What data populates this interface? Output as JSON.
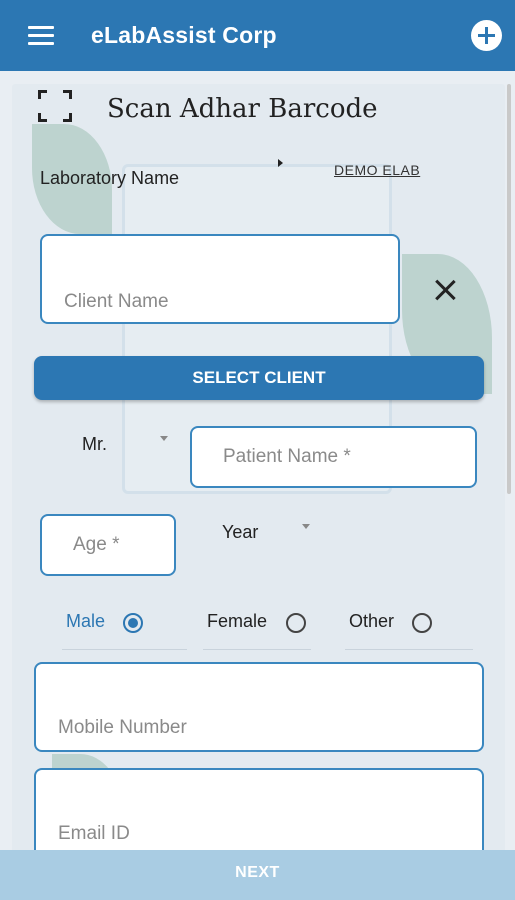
{
  "appbar": {
    "title": "eLabAssist Corp",
    "menu_icon": "hamburger-menu-icon",
    "add_icon": "add-circle-icon",
    "color": "#2c77b3"
  },
  "scan": {
    "icon": "scan-frame-icon",
    "label": "Scan Adhar Barcode"
  },
  "laboratory": {
    "label": "Laboratory Name",
    "value": "DEMO ELAB"
  },
  "client": {
    "placeholder": "Client Name",
    "clear_icon": "close-icon",
    "select_label": "SELECT CLIENT"
  },
  "patient": {
    "title_value": "Mr.",
    "name_placeholder": "Patient Name *",
    "age_placeholder": "Age *",
    "age_unit": "Year"
  },
  "gender": {
    "options": [
      {
        "label": "Male",
        "selected": true
      },
      {
        "label": "Female",
        "selected": false
      },
      {
        "label": "Other",
        "selected": false
      }
    ]
  },
  "contact": {
    "mobile_placeholder": "Mobile Number",
    "email_placeholder": "Email ID"
  },
  "footer": {
    "next_label": "NEXT"
  }
}
